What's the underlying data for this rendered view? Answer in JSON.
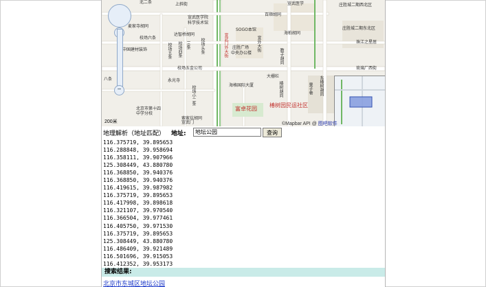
{
  "map": {
    "labels": [
      {
        "text": "北二条"
      },
      {
        "text": "庄胜城二期西北区"
      },
      {
        "text": "上斜街"
      },
      {
        "text": "宣武医学院"
      },
      {
        "text": "宣武医学"
      },
      {
        "text": "百顺胡同"
      },
      {
        "text": "科学技术馆"
      },
      {
        "text": "麦家寺胡同"
      },
      {
        "text": "SOGO本馆"
      },
      {
        "text": "庄胜城二期东北区"
      },
      {
        "text": "海柏胡同"
      },
      {
        "text": "校场六条"
      },
      {
        "text": "达智桥胡同"
      },
      {
        "text": "中国建材装饰"
      },
      {
        "text": "庄胜广场"
      },
      {
        "text": "中央办公楼"
      },
      {
        "text": "珠江之星居"
      },
      {
        "text": "宣外大街"
      },
      {
        "text": "教子胡同"
      },
      {
        "text": "宣武门外大街"
      },
      {
        "text": "校场头条"
      },
      {
        "text": "果子巷"
      },
      {
        "text": "琉璃厂西街"
      },
      {
        "text": "校场五条"
      },
      {
        "text": "校场四条"
      },
      {
        "text": "三条"
      },
      {
        "text": "校场五金公司"
      },
      {
        "text": "大栅栏"
      },
      {
        "text": "永光寺"
      },
      {
        "text": "椿树胡同"
      },
      {
        "text": "海格国际大厦"
      },
      {
        "text": "东椿树胡同"
      },
      {
        "text": "校场小二条"
      },
      {
        "text": "北京市第十四"
      },
      {
        "text": "中学分校"
      },
      {
        "text": "宣武门"
      },
      {
        "text": "八条"
      },
      {
        "text": "富卓花园"
      },
      {
        "text": "椿树园民运社区"
      },
      {
        "text": "索家坑胡同"
      }
    ],
    "scale_label": "200米",
    "copyright_left": "©Mapbar API",
    "copyright_sep": "@",
    "copyright_link": "图吧软件"
  },
  "geo": {
    "title": "地理解析（地址匹配）",
    "address_label": "地址:",
    "address_value": "地坛公园",
    "query_button": "查询"
  },
  "coords": [
    "116.375719, 39.895653",
    "116.288848, 39.958694",
    "116.358111, 39.907966",
    "125.308449, 43.880780",
    "116.368850, 39.940376",
    "116.368850, 39.940376",
    "116.419615, 39.987982",
    "116.375719, 39.895653",
    "116.417998, 39.898618",
    "116.321107, 39.970540",
    "116.366504, 39.977461",
    "116.405750, 39.971530",
    "116.375719, 39.895653",
    "125.308449, 43.880780",
    "116.486409, 39.921489",
    "116.501696, 39.915053",
    "116.412352, 39.953173"
  ],
  "results": {
    "header": "搜索结果:",
    "items": [
      "北京市东城区地坛公园"
    ]
  }
}
